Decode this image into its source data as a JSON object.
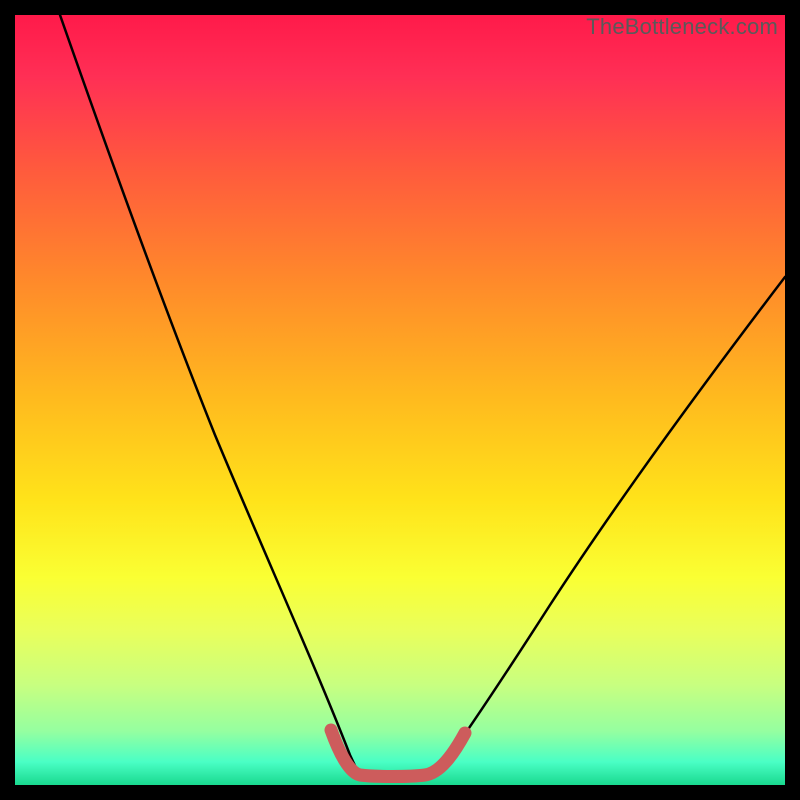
{
  "watermark": "TheBottleneck.com",
  "chart_data": {
    "type": "line",
    "title": "",
    "xlabel": "",
    "ylabel": "",
    "xlim": [
      0,
      100
    ],
    "ylim": [
      0,
      100
    ],
    "grid": false,
    "legend": false,
    "series": [
      {
        "name": "left-curve",
        "color": "#000000",
        "x": [
          6,
          12,
          18,
          24,
          30,
          34,
          38,
          41,
          43,
          44.5
        ],
        "y": [
          100,
          84,
          68,
          53,
          38,
          28,
          18,
          10,
          5,
          2
        ]
      },
      {
        "name": "right-curve",
        "color": "#000000",
        "x": [
          55,
          58,
          62,
          67,
          73,
          80,
          88,
          96,
          100
        ],
        "y": [
          2,
          6,
          12,
          20,
          30,
          40,
          51,
          61,
          66
        ]
      },
      {
        "name": "bottom-highlight",
        "color": "#cd5c5c",
        "x": [
          41,
          43,
          44.5,
          47,
          50,
          53,
          55,
          57,
          58.5
        ],
        "y": [
          7,
          3,
          1.5,
          1,
          1,
          1,
          1.5,
          3.5,
          6
        ]
      }
    ],
    "background_gradient": {
      "top": "#ff1a4a",
      "middle": "#ffe31a",
      "bottom": "#19d98f"
    }
  }
}
